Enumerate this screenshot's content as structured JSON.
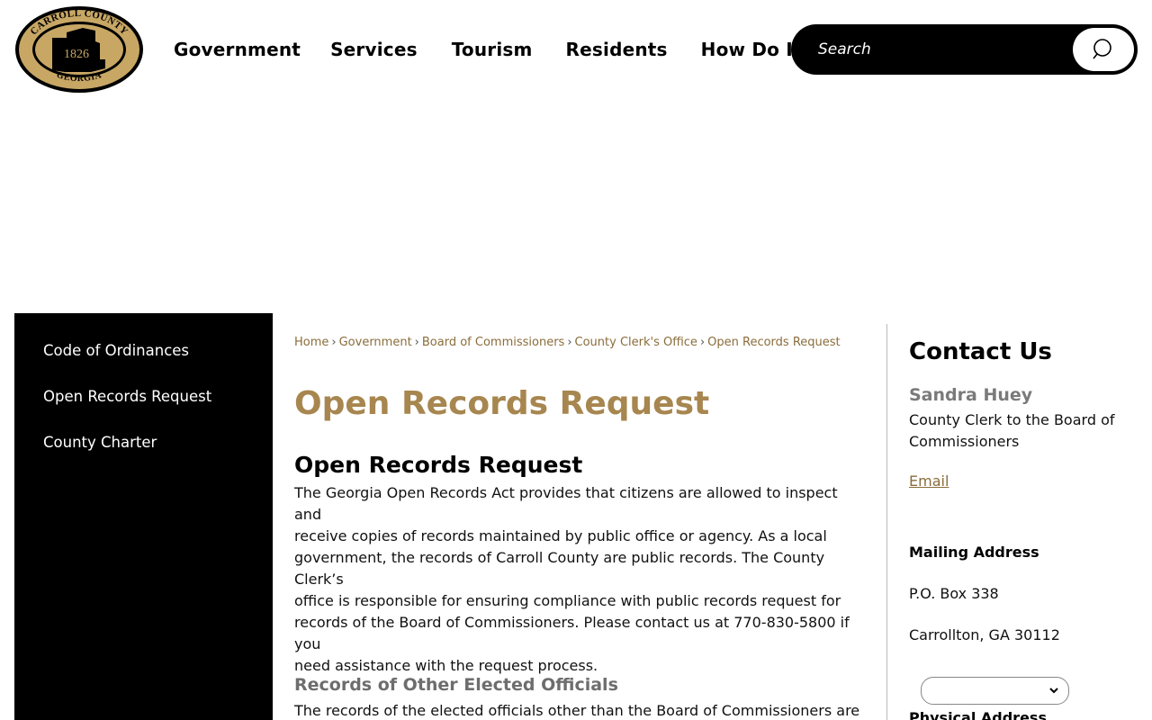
{
  "header": {
    "logo": {
      "top_text": "CARROLL COUNTY",
      "bottom_text": "GEORGIA",
      "year": "1826",
      "colors": {
        "gold": "#c8a765",
        "black": "#000000"
      }
    },
    "nav": [
      "Government",
      "Services",
      "Tourism",
      "Residents",
      "How Do I..."
    ],
    "search": {
      "placeholder": "Search",
      "icon": "search-icon"
    }
  },
  "sidebar": {
    "items": [
      {
        "label": "Code of Ordinances"
      },
      {
        "label": "Open Records Request"
      },
      {
        "label": "County Charter"
      }
    ]
  },
  "breadcrumb": {
    "items": [
      "Home",
      "Government",
      "Board of Commissioners",
      "County Clerk's Office"
    ],
    "current": "Open Records Request",
    "separator": "›"
  },
  "main": {
    "page_title": "Open Records Request",
    "section_title": "Open Records Request",
    "paragraph_lines": [
      "The Georgia Open Records Act provides that citizens are allowed to inspect and",
      "receive copies of records maintained by public office or agency. As a local",
      "government, the records of Carroll County are public records. The County Clerk’s",
      "office is responsible for ensuring compliance with public records request for",
      "records of the Board of Commissioners. Please contact us at 770-830-5800 if you",
      "need assistance with the request process."
    ],
    "subsection_title": "Records of Other Elected Officials",
    "subsection_text": "The records of the elected officials other than the Board of Commissioners are"
  },
  "contact": {
    "title": "Contact Us",
    "name": "Sandra Huey",
    "role": "County Clerk to the Board of Commissioners",
    "email_label": "Email",
    "mailing_label": "Mailing Address",
    "mailing_line1": "P.O. Box 338",
    "mailing_line2": "Carrollton, GA 30112",
    "select_value": "",
    "physical_label": "Physical Address"
  },
  "colors": {
    "accent_gold": "#a7864f",
    "breadcrumb_brown": "#8a6d3b",
    "sidebar_bg": "#000000"
  }
}
